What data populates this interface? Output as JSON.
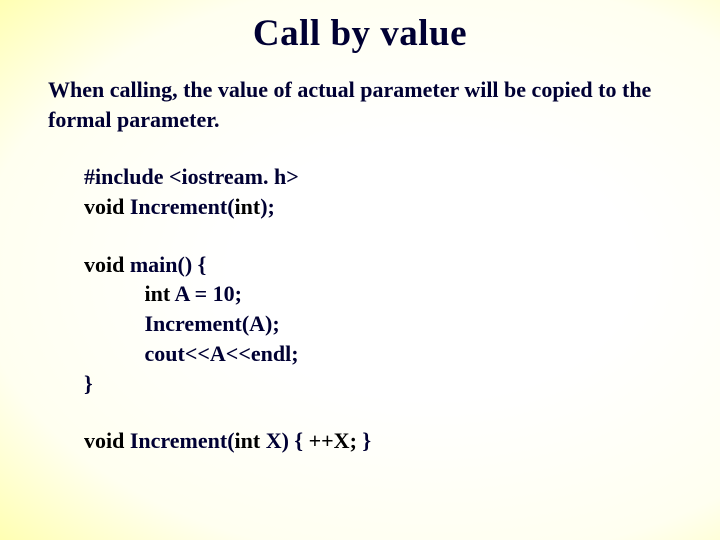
{
  "title": "Call by value",
  "intro": "When calling, the value of actual parameter will be copied to the formal parameter.",
  "code": {
    "l1": "#include <iostream. h>",
    "l2a": "void",
    "l2b": " Increment(",
    "l2c": "int",
    "l2d": ");",
    "l3a": "void",
    "l3b": " main() {",
    "l4a": "           int",
    "l4b": " A = 10;",
    "l5": "           Increment(A);",
    "l6": "           cout<<A<<endl;",
    "l7": "}",
    "l8a": "void",
    "l8b": " Increment(",
    "l8c": "int",
    "l8d1": " X) { ",
    "l8d2": "++X; ",
    "l8d3": "}"
  }
}
